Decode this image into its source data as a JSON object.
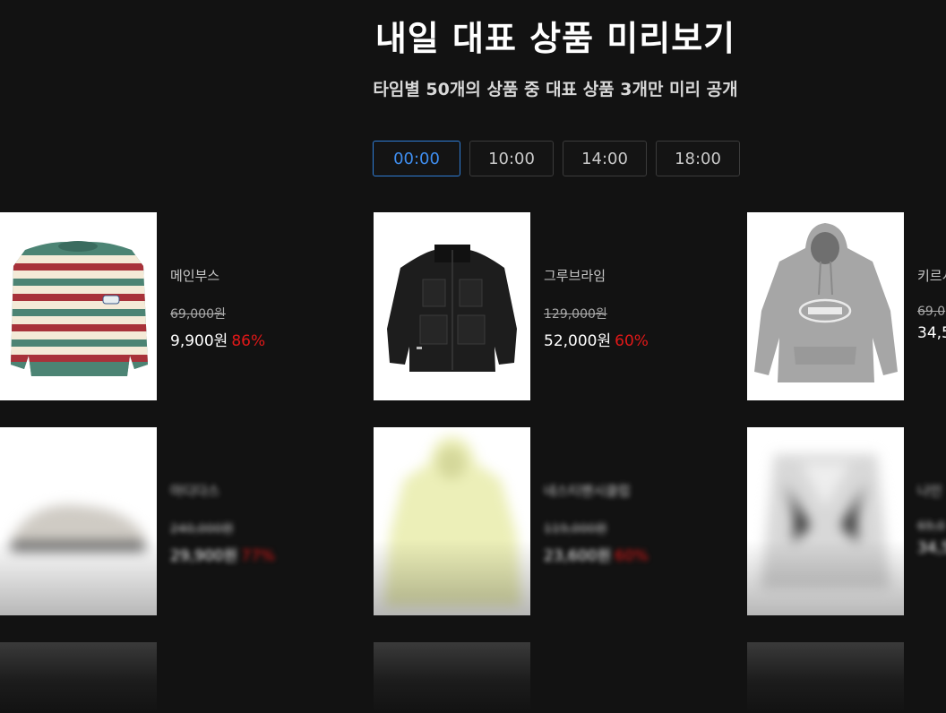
{
  "header": {
    "title": "내일 대표 상품 미리보기",
    "subtitle": "타임별 50개의 상품 중 대표 상품 3개만 미리 공개"
  },
  "tabs": [
    {
      "label": "00:00",
      "active": true
    },
    {
      "label": "10:00",
      "active": false
    },
    {
      "label": "14:00",
      "active": false
    },
    {
      "label": "18:00",
      "active": false
    }
  ],
  "products": [
    {
      "brand": "메인부스",
      "original_price": "69,000원",
      "price": "9,900원",
      "discount": "86%",
      "image": "striped-knit-sweater",
      "blurred": false
    },
    {
      "brand": "그루브라임",
      "original_price": "129,000원",
      "price": "52,000원",
      "discount": "60%",
      "image": "black-padded-jacket",
      "blurred": false
    },
    {
      "brand": "키르시",
      "original_price": "69,0",
      "price": "34,5",
      "discount": "",
      "image": "gray-logo-hoodie",
      "blurred": false
    },
    {
      "brand": "아디다스",
      "original_price": "240,000원",
      "price": "29,900원",
      "discount": "77%",
      "image": "white-sneaker",
      "blurred": true
    },
    {
      "brand": "네스티팬시클럽",
      "original_price": "119,000원",
      "price": "23,600원",
      "discount": "60%",
      "image": "yellow-zip-hoodie",
      "blurred": true
    },
    {
      "brand": "나인",
      "original_price": "69,0",
      "price": "34,5",
      "discount": "",
      "image": "gray-cardigan",
      "blurred": true
    }
  ],
  "colors": {
    "background": "#121212",
    "accent": "#3f8ef0",
    "discount": "#e01818"
  }
}
